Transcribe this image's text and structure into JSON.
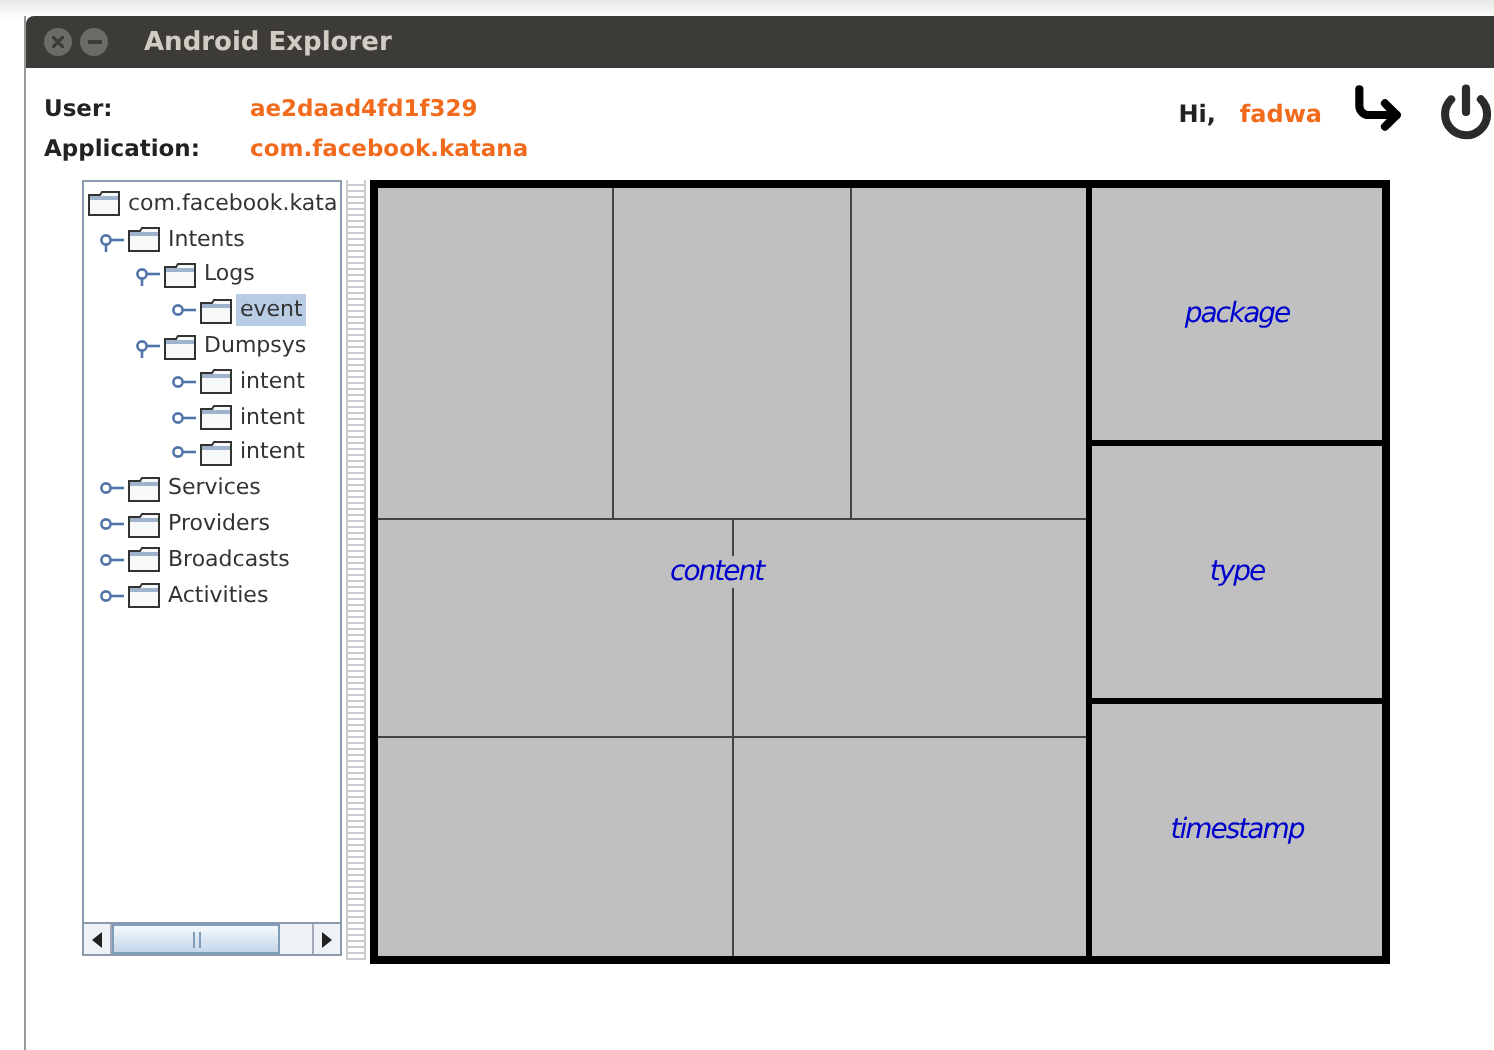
{
  "window": {
    "title": "Android Explorer"
  },
  "user": {
    "label": "User:",
    "value": "ae2daad4fd1f329"
  },
  "application": {
    "label": "Application:",
    "value": "com.facebook.katana"
  },
  "greeting": {
    "label": "Hi,",
    "name": "fadwa"
  },
  "tree": {
    "root": "com.facebook.kata",
    "items": [
      {
        "label": "Intents",
        "expanded": true,
        "selected": false,
        "children": [
          {
            "label": "Logs",
            "expanded": true,
            "selected": false,
            "children": [
              {
                "label": "event",
                "expanded": false,
                "selected": true
              }
            ]
          },
          {
            "label": "Dumpsys",
            "expanded": true,
            "selected": false,
            "children": [
              {
                "label": "intent",
                "expanded": false,
                "selected": false
              },
              {
                "label": "intent",
                "expanded": false,
                "selected": false
              },
              {
                "label": "intent",
                "expanded": false,
                "selected": false
              }
            ]
          }
        ]
      },
      {
        "label": "Services",
        "expanded": false,
        "selected": false
      },
      {
        "label": "Providers",
        "expanded": false,
        "selected": false
      },
      {
        "label": "Broadcasts",
        "expanded": false,
        "selected": false
      },
      {
        "label": "Activities",
        "expanded": false,
        "selected": false
      }
    ]
  },
  "grid": {
    "content_label": "content",
    "side_labels": [
      "package",
      "type",
      "timestamp"
    ]
  }
}
